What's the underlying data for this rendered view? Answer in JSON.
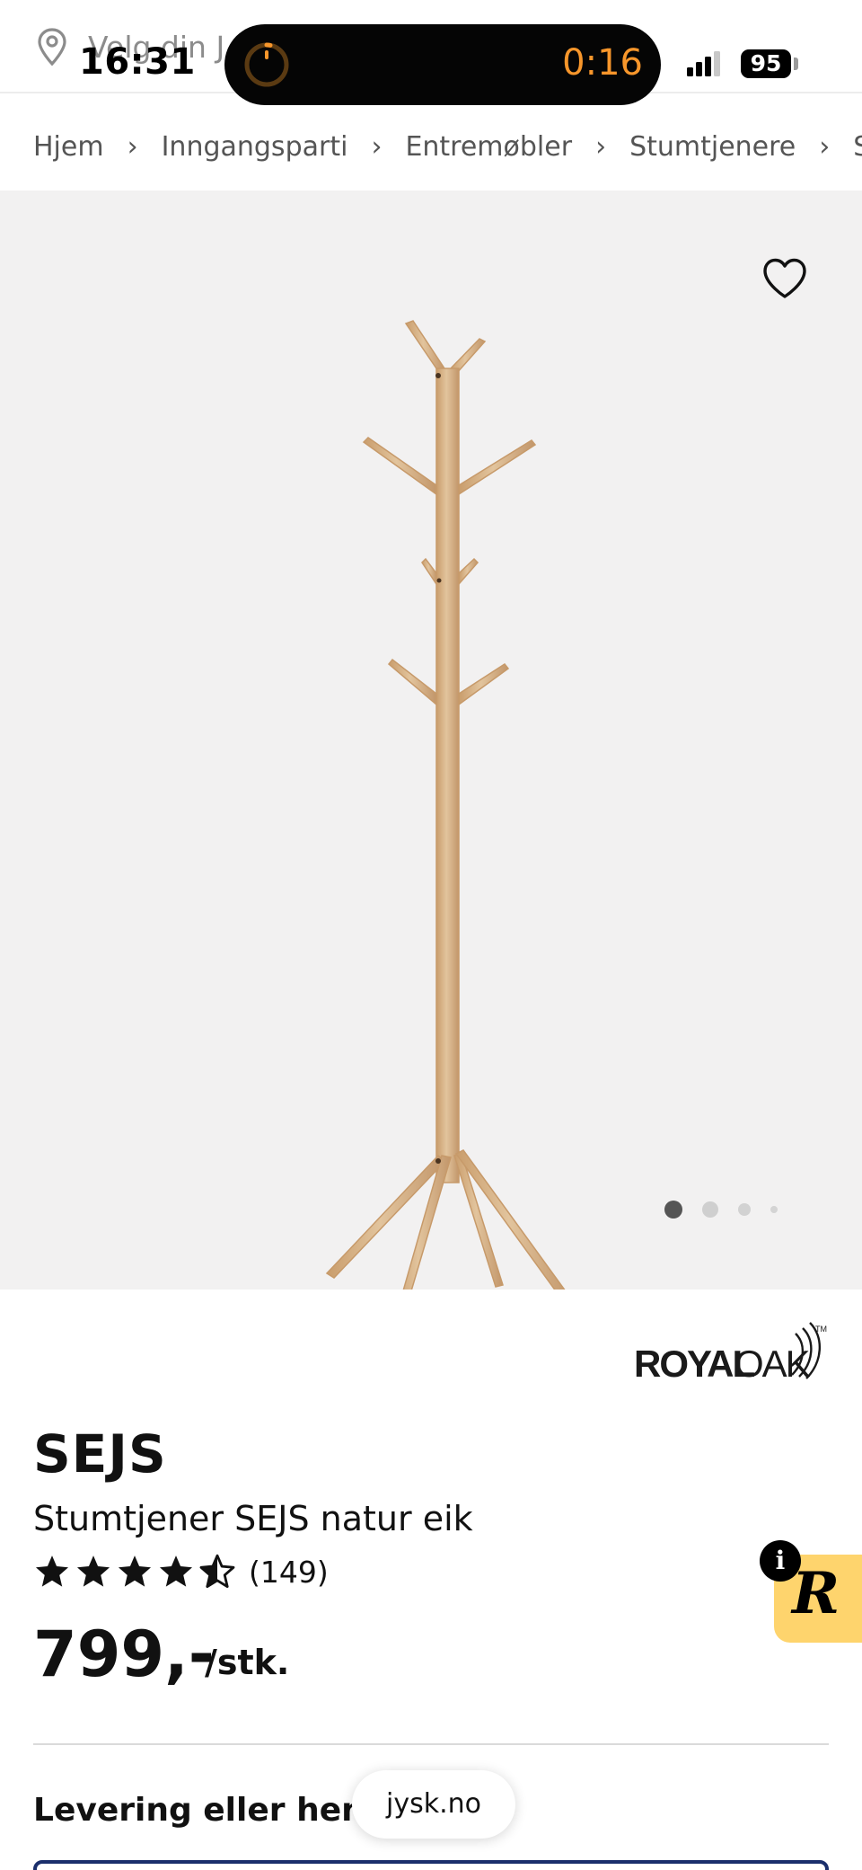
{
  "status_bar": {
    "time": "16:31",
    "live_timer": "0:16",
    "battery": "95"
  },
  "store_selector": {
    "label": "Velg din J",
    "icon": "location-pin-icon"
  },
  "breadcrumb": [
    "Hjem",
    "Inngangsparti",
    "Entremøbler",
    "Stumtjenere",
    "Stum"
  ],
  "gallery": {
    "favorite_icon": "heart-outline-icon",
    "image_count": 4,
    "active_index": 0
  },
  "brand": {
    "logo_text": "ROYALOAK",
    "trademark": "™"
  },
  "product": {
    "name": "SEJS",
    "description": "Stumtjener SEJS natur eik",
    "rating": 4.5,
    "rating_max": 5,
    "review_count": "(149)",
    "price": "799,-",
    "unit": "/stk."
  },
  "delivery": {
    "title": "Levering eller hentin"
  },
  "browser": {
    "url": "jysk.no"
  },
  "widget": {
    "letter": "R",
    "info_glyph": "i"
  },
  "colors": {
    "accent_navy": "#1b2f6c",
    "widget_yellow": "#fed46d",
    "timer_orange": "#f7962b",
    "wood": "#d8b58c"
  }
}
